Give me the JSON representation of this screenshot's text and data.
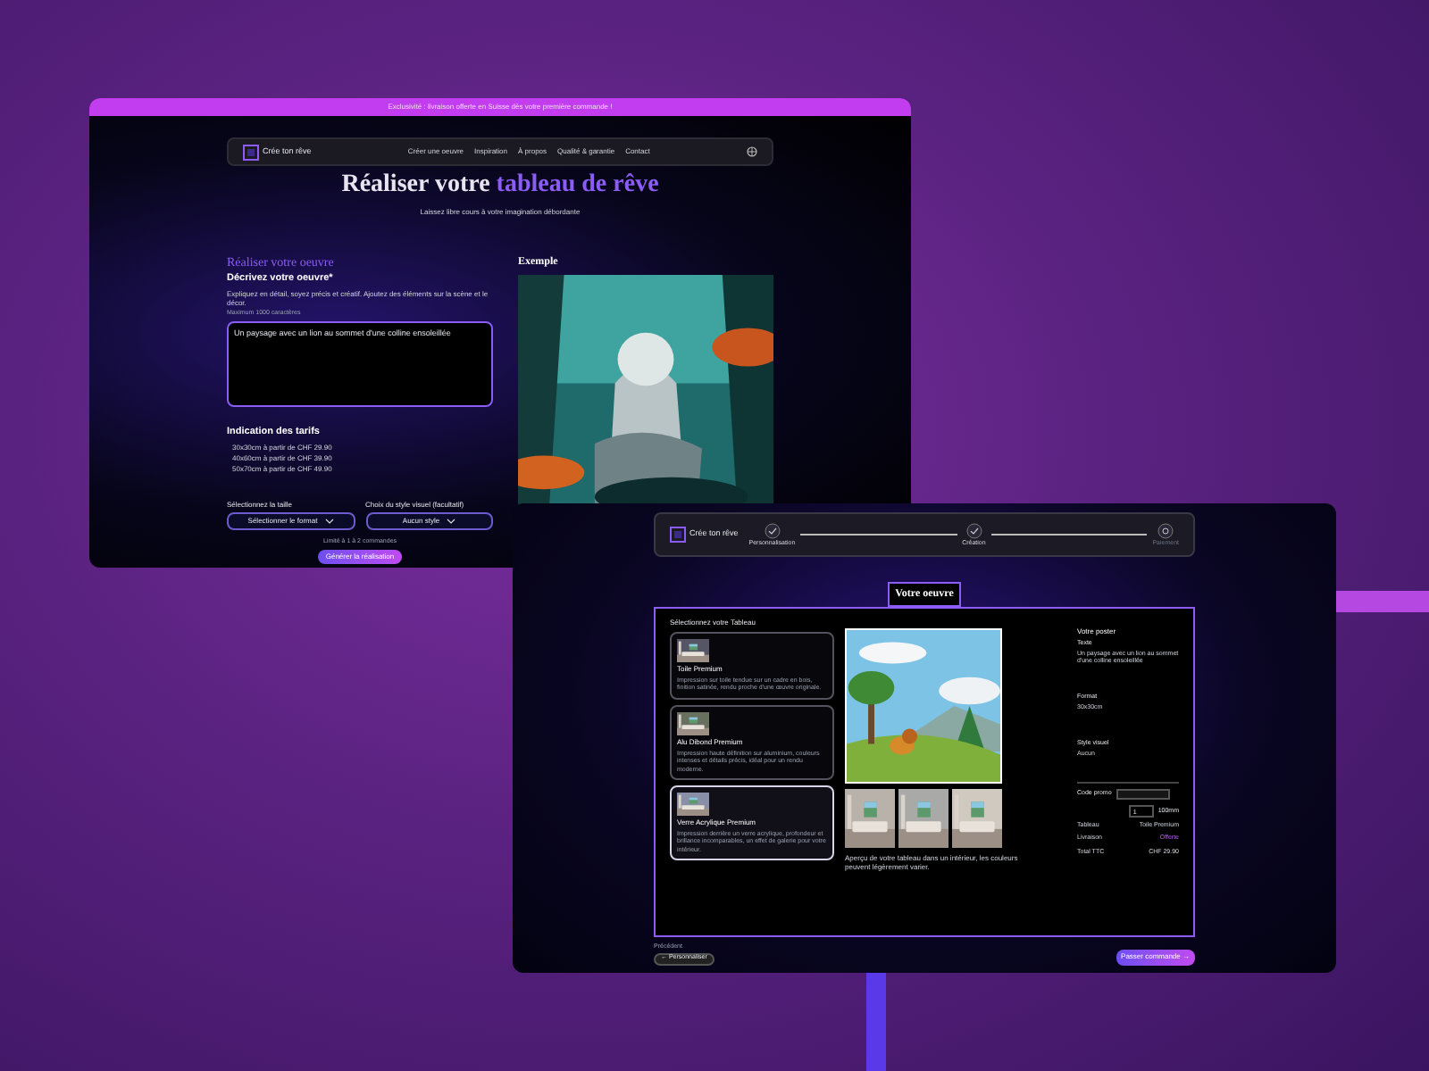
{
  "form_page": {
    "banner": "Exclusivité : livraison offerte en Suisse dès votre première commande !",
    "nav": {
      "logo": "Crée ton rêve",
      "links": [
        "Créer une oeuvre",
        "Inspiration",
        "À propos",
        "Qualité & garantie",
        "Contact"
      ]
    },
    "heading": {
      "lead": "Réaliser votre",
      "accent": "tableau de rêve"
    },
    "subtitle": "Laissez libre cours à votre imagination débordante",
    "form": {
      "title": "Réaliser votre oeuvre",
      "label": "Décrivez votre oeuvre*",
      "hint": "Expliquez en détail, soyez précis et créatif. Ajoutez des éléments sur la scène et le décor.",
      "limit": "Maximum 1000 caractères",
      "value": "Un paysage avec un lion au sommet d'une colline ensoleillée",
      "pricing_title": "Indication des tarifs",
      "prices": [
        "30x30cm à partir de CHF 29.90",
        "40x60cm à partir de CHF 39.90",
        "50x70cm à partir de CHF 49.90"
      ],
      "selects": [
        {
          "label": "Sélectionnez la taille",
          "value": "Sélectionner le format"
        },
        {
          "label": "Choix du style visuel (facultatif)",
          "value": "Aucun style"
        }
      ],
      "note": "Limité à 1 à 2 commandes",
      "button": "Générer la réalisation"
    },
    "example": {
      "title": "Exemple"
    }
  },
  "order_page": {
    "logo": "Crée ton rêve",
    "steps": [
      {
        "label": "Personnalisation",
        "done": true
      },
      {
        "label": "Création",
        "done": true
      },
      {
        "label": "Paiement",
        "done": false
      }
    ],
    "section_title": "Votre oeuvre",
    "cards_title": "Sélectionnez votre Tableau",
    "cards": [
      {
        "title": "Toile Premium",
        "text": "Impression sur toile tendue sur un cadre en bois, finition satinée, rendu proche d'une œuvre originale.",
        "selected": false
      },
      {
        "title": "Alu Dibond Premium",
        "text": "Impression haute définition sur aluminium, couleurs intenses et détails précis, idéal pour un rendu moderne.",
        "selected": false
      },
      {
        "title": "Verre Acrylique Premium",
        "text": "Impression derrière un verre acrylique, profondeur et brillance incomparables, un effet de galerie pour votre intérieur.",
        "selected": true
      }
    ],
    "caption": "Aperçu de votre tableau dans un intérieur, les couleurs peuvent légèrement varier.",
    "summary": {
      "title": "Votre poster",
      "fields": [
        {
          "label": "Texte",
          "value": "Un paysage avec un lion au sommet d'une colline ensoleillée"
        },
        {
          "label": "Format",
          "value": "30x30cm"
        },
        {
          "label": "Style visuel",
          "value": "Aucun"
        }
      ],
      "promo_label": "Code promo",
      "quantity": "1",
      "unit": "100mm",
      "lines": [
        {
          "label": "Tableau",
          "value": "Toile Premium",
          "accent": false
        },
        {
          "label": "Livraison",
          "value": "Offerte",
          "accent": true
        },
        {
          "label": "Total TTC",
          "value": "CHF 29.90",
          "accent": false
        }
      ]
    },
    "back_label": "Précédent",
    "back_button": "← Personnaliser",
    "next_button": "Passer commande →"
  }
}
